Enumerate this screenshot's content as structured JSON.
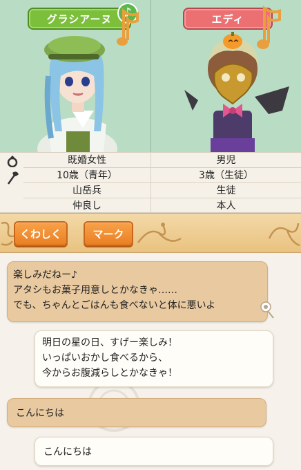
{
  "characters": [
    {
      "name": "グラシアーヌ",
      "music": "♪"
    },
    {
      "name": "エディ"
    }
  ],
  "profile_rows": [
    {
      "left": "既婚女性",
      "right": "男児"
    },
    {
      "left": "10歳（青年）",
      "right": "3歳（生徒）"
    },
    {
      "left": "山岳兵",
      "right": "生徒"
    },
    {
      "left": "仲良し",
      "right": "本人"
    }
  ],
  "icons": [
    "ring-icon",
    "axe-icon"
  ],
  "actions": {
    "detail_label": "くわしく",
    "mark_label": "マーク"
  },
  "messages": [
    {
      "side": "received",
      "lines": [
        "楽しみだねー♪",
        "アタシもお菓子用意しとかなきゃ……",
        "でも、ちゃんとごはんも食べないと体に悪いよ"
      ]
    },
    {
      "side": "sent",
      "lines": [
        "明日の星の日、すげー楽しみ！",
        "いっぱいおかし食べるから、",
        "今からお腹減らしとかなきゃ！"
      ]
    },
    {
      "side": "received",
      "lines": [
        "こんにちは"
      ]
    },
    {
      "side": "sent",
      "lines": [
        "こんにちは"
      ]
    }
  ],
  "colors": {
    "portrait_bg": "#b9dcc5",
    "name_green": "#7cbf3b",
    "name_red": "#ec6f72",
    "button_orange": "#ef8c30",
    "bubble_received": "#e8c9a0",
    "bubble_sent": "#fffdf8"
  }
}
